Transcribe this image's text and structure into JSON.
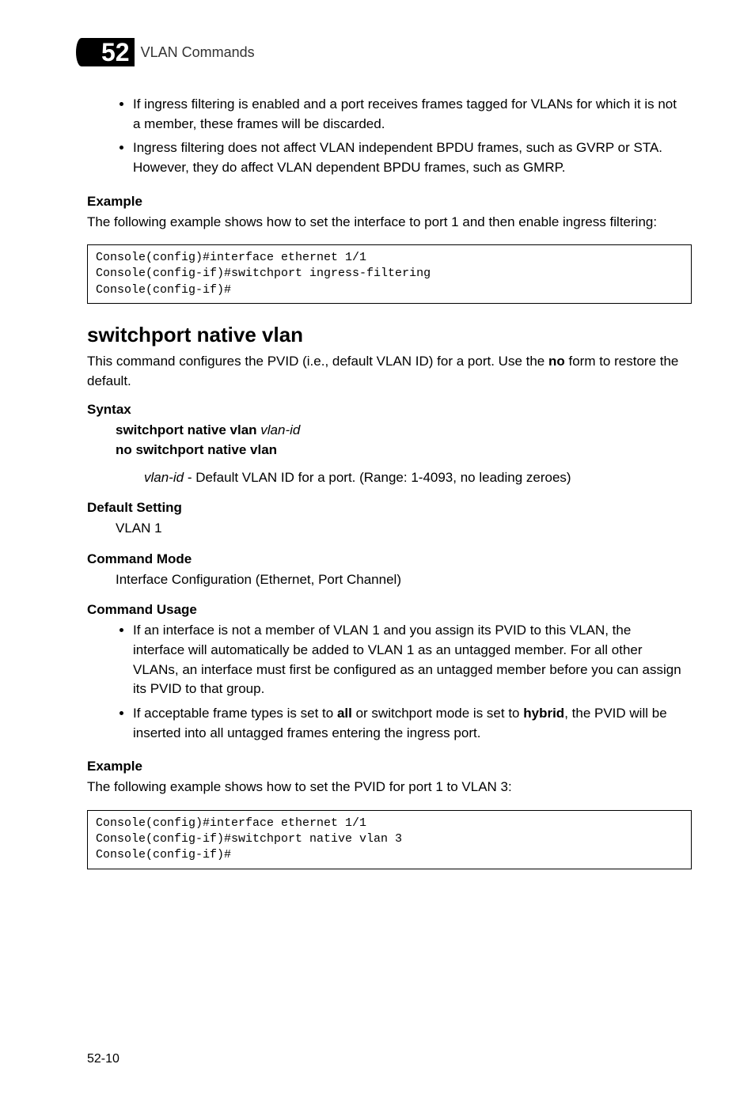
{
  "chapter": {
    "number": "52",
    "title": "VLAN Commands"
  },
  "top_bullets": [
    "If ingress filtering is enabled and a port receives frames tagged for VLANs for which it is not a member, these frames will be discarded.",
    "Ingress filtering does not affect VLAN independent BPDU frames, such as GVRP or STA. However, they do affect VLAN dependent BPDU frames, such as GMRP."
  ],
  "example1": {
    "label": "Example",
    "text": "The following example shows how to set the interface to port 1 and then enable ingress filtering:",
    "code": "Console(config)#interface ethernet 1/1\nConsole(config-if)#switchport ingress-filtering\nConsole(config-if)#"
  },
  "heading": "switchport native vlan",
  "intro_pre": "This command configures the PVID (i.e., default VLAN ID) for a port. Use the ",
  "intro_bold": "no",
  "intro_post": " form to restore the default.",
  "syntax": {
    "label": "Syntax",
    "line1_bold": "switchport native vlan ",
    "line1_ital": "vlan-id",
    "line2_bold": "no switchport native vlan",
    "param_ital": "vlan-id",
    "param_rest": " - Default VLAN ID for a port. (Range: 1-4093, no leading zeroes)"
  },
  "default_setting": {
    "label": "Default Setting",
    "value": "VLAN 1"
  },
  "command_mode": {
    "label": "Command Mode",
    "value": "Interface Configuration (Ethernet, Port Channel)"
  },
  "command_usage": {
    "label": "Command Usage",
    "b1": "If an interface is not a member of VLAN 1 and you assign its PVID to this VLAN, the interface will automatically be added to VLAN 1 as an untagged member. For all other VLANs, an interface must first be configured as an untagged member before you can assign its PVID to that group.",
    "b2_pre": "If acceptable frame types is set to ",
    "b2_bold1": "all",
    "b2_mid": " or switchport mode is set to ",
    "b2_bold2": "hybrid",
    "b2_post": ", the PVID will be inserted into all untagged frames entering the ingress port."
  },
  "example2": {
    "label": "Example",
    "text": "The following example shows how to set the PVID for port 1 to VLAN 3:",
    "code": "Console(config)#interface ethernet 1/1\nConsole(config-if)#switchport native vlan 3\nConsole(config-if)#"
  },
  "page_num": "52-10"
}
